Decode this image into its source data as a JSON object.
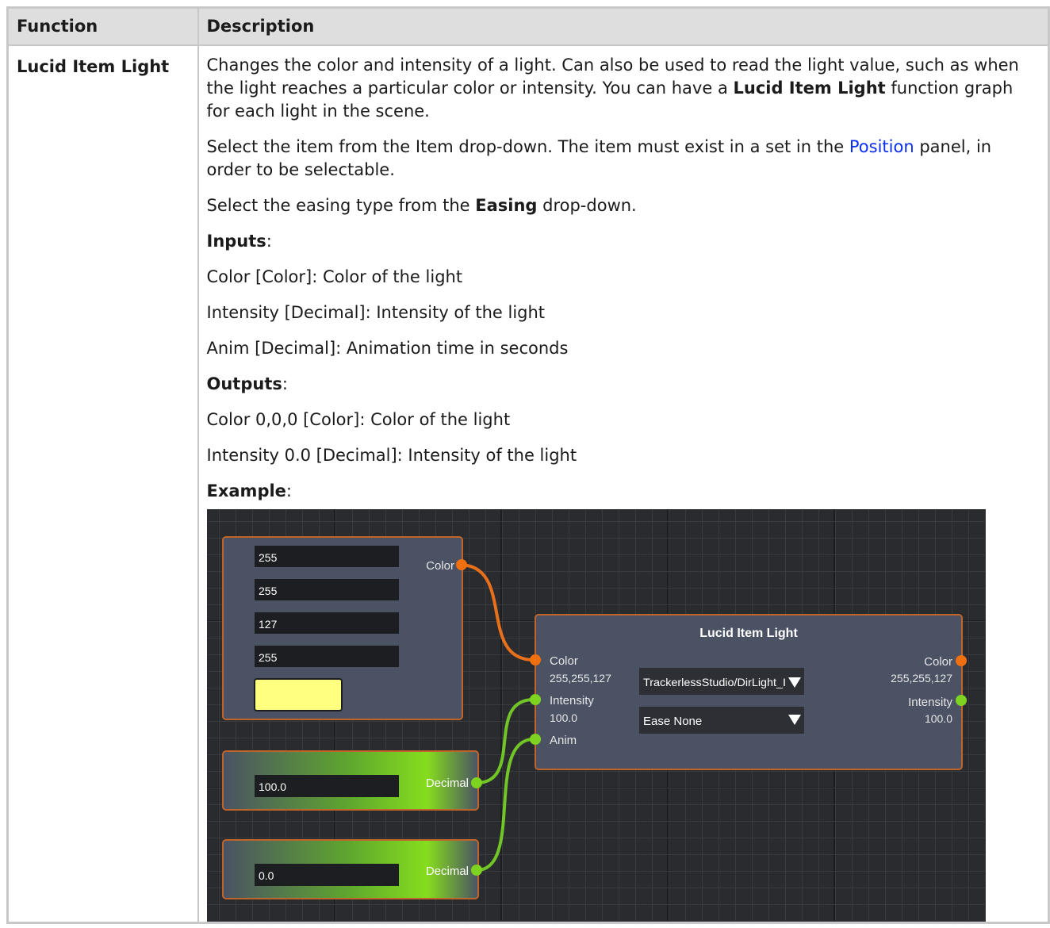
{
  "table": {
    "headers": [
      "Function",
      "Description"
    ],
    "row": {
      "function": "Lucid Item Light",
      "desc1_a": "Changes the color and intensity of a light. Can also be used to read the light value, such as when the light reaches a particular color or intensity. You can have a ",
      "desc1_bold": "Lucid Item Light",
      "desc1_b": " function graph for each light in the scene.",
      "desc2_a": "Select the item from the Item drop-down. The item must exist in a set in the ",
      "desc2_link": "Position",
      "desc2_b": " panel, in order to be selectable.",
      "desc3_a": "Select the easing type from the ",
      "desc3_bold": "Easing",
      "desc3_b": " drop-down.",
      "inputs_label": "Inputs",
      "inputs": [
        "Color [Color]: Color of the light",
        "Intensity [Decimal]: Intensity of the light",
        "Anim [Decimal]: Animation time in seconds"
      ],
      "outputs_label": "Outputs",
      "outputs": [
        "Color 0,0,0 [Color]: Color of the light",
        "Intensity 0.0 [Decimal]: Intensity of the light"
      ],
      "example_label": "Example",
      "colon": ":"
    }
  },
  "graph": {
    "color_node": {
      "fields": [
        "255",
        "255",
        "127",
        "255"
      ],
      "output_label": "Color",
      "swatch_color": "#ffff80"
    },
    "decimal_node_1": {
      "value": "100.0",
      "output_label": "Decimal"
    },
    "decimal_node_2": {
      "value": "0.0",
      "output_label": "Decimal"
    },
    "light_node": {
      "title": "Lucid Item Light",
      "in_color_label": "Color",
      "in_color_value": "255,255,127",
      "in_intensity_label": "Intensity",
      "in_intensity_value": "100.0",
      "in_anim_label": "Anim",
      "item_dropdown": "TrackerlessStudio/DirLight_I",
      "easing_dropdown": "Ease None",
      "out_color_label": "Color",
      "out_color_value": "255,255,127",
      "out_intensity_label": "Intensity",
      "out_intensity_value": "100.0"
    },
    "colors": {
      "node_bg": "#4a5264",
      "node_border": "#c0652a",
      "color_port": "#f07010",
      "decimal_port": "#7ed321",
      "wire_color": "#e8701a",
      "wire_decimal": "#72c526"
    }
  }
}
